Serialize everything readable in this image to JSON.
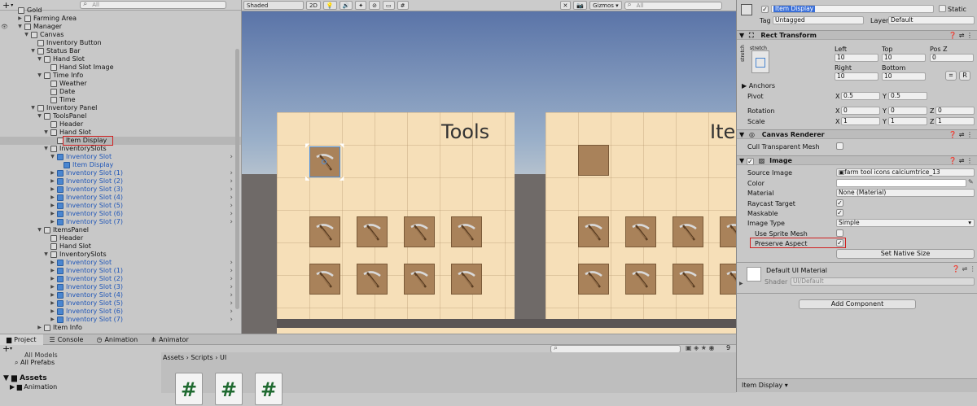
{
  "hierarchy": {
    "search_placeholder": "All",
    "rows": [
      {
        "label": "Gold",
        "indent": 0,
        "tri": "",
        "blue": false,
        "sel": false,
        "chev": false
      },
      {
        "label": "Farming Area",
        "indent": 1,
        "tri": "▶",
        "blue": false,
        "sel": false,
        "chev": false
      },
      {
        "label": "Manager",
        "indent": 1,
        "tri": "▼",
        "blue": false,
        "sel": false,
        "chev": false
      },
      {
        "label": "Canvas",
        "indent": 2,
        "tri": "▼",
        "blue": false,
        "sel": false,
        "chev": false
      },
      {
        "label": "Inventory Button",
        "indent": 3,
        "tri": "",
        "blue": false,
        "sel": false,
        "chev": false
      },
      {
        "label": "Status Bar",
        "indent": 3,
        "tri": "▼",
        "blue": false,
        "sel": false,
        "chev": false
      },
      {
        "label": "Hand Slot",
        "indent": 4,
        "tri": "▼",
        "blue": false,
        "sel": false,
        "chev": false
      },
      {
        "label": "Hand Slot Image",
        "indent": 5,
        "tri": "",
        "blue": false,
        "sel": false,
        "chev": false
      },
      {
        "label": "Time Info",
        "indent": 4,
        "tri": "▼",
        "blue": false,
        "sel": false,
        "chev": false
      },
      {
        "label": "Weather",
        "indent": 5,
        "tri": "",
        "blue": false,
        "sel": false,
        "chev": false
      },
      {
        "label": "Date",
        "indent": 5,
        "tri": "",
        "blue": false,
        "sel": false,
        "chev": false
      },
      {
        "label": "Time",
        "indent": 5,
        "tri": "",
        "blue": false,
        "sel": false,
        "chev": false
      },
      {
        "label": "Inventory Panel",
        "indent": 3,
        "tri": "▼",
        "blue": false,
        "sel": false,
        "chev": false
      },
      {
        "label": "ToolsPanel",
        "indent": 4,
        "tri": "▼",
        "blue": false,
        "sel": false,
        "chev": false
      },
      {
        "label": "Header",
        "indent": 5,
        "tri": "",
        "blue": false,
        "sel": false,
        "chev": false
      },
      {
        "label": "Hand Slot",
        "indent": 5,
        "tri": "▼",
        "blue": false,
        "sel": false,
        "chev": false
      },
      {
        "label": "Item Display",
        "indent": 6,
        "tri": "",
        "blue": false,
        "sel": true,
        "chev": false
      },
      {
        "label": "InventorySlots",
        "indent": 5,
        "tri": "▼",
        "blue": false,
        "sel": false,
        "chev": false
      },
      {
        "label": "Inventory Slot",
        "indent": 6,
        "tri": "▼",
        "blue": true,
        "sel": false,
        "chev": true
      },
      {
        "label": "Item Display",
        "indent": 7,
        "tri": "",
        "blue": true,
        "sel": false,
        "chev": false
      },
      {
        "label": "Inventory Slot (1)",
        "indent": 6,
        "tri": "▶",
        "blue": true,
        "sel": false,
        "chev": true
      },
      {
        "label": "Inventory Slot (2)",
        "indent": 6,
        "tri": "▶",
        "blue": true,
        "sel": false,
        "chev": true
      },
      {
        "label": "Inventory Slot (3)",
        "indent": 6,
        "tri": "▶",
        "blue": true,
        "sel": false,
        "chev": true
      },
      {
        "label": "Inventory Slot (4)",
        "indent": 6,
        "tri": "▶",
        "blue": true,
        "sel": false,
        "chev": true
      },
      {
        "label": "Inventory Slot (5)",
        "indent": 6,
        "tri": "▶",
        "blue": true,
        "sel": false,
        "chev": true
      },
      {
        "label": "Inventory Slot (6)",
        "indent": 6,
        "tri": "▶",
        "blue": true,
        "sel": false,
        "chev": true
      },
      {
        "label": "Inventory Slot (7)",
        "indent": 6,
        "tri": "▶",
        "blue": true,
        "sel": false,
        "chev": true
      },
      {
        "label": "ItemsPanel",
        "indent": 4,
        "tri": "▼",
        "blue": false,
        "sel": false,
        "chev": false
      },
      {
        "label": "Header",
        "indent": 5,
        "tri": "",
        "blue": false,
        "sel": false,
        "chev": false
      },
      {
        "label": "Hand Slot",
        "indent": 5,
        "tri": "",
        "blue": false,
        "sel": false,
        "chev": false
      },
      {
        "label": "InventorySlots",
        "indent": 5,
        "tri": "▼",
        "blue": false,
        "sel": false,
        "chev": false
      },
      {
        "label": "Inventory Slot",
        "indent": 6,
        "tri": "▶",
        "blue": true,
        "sel": false,
        "chev": true
      },
      {
        "label": "Inventory Slot (1)",
        "indent": 6,
        "tri": "▶",
        "blue": true,
        "sel": false,
        "chev": true
      },
      {
        "label": "Inventory Slot (2)",
        "indent": 6,
        "tri": "▶",
        "blue": true,
        "sel": false,
        "chev": true
      },
      {
        "label": "Inventory Slot (3)",
        "indent": 6,
        "tri": "▶",
        "blue": true,
        "sel": false,
        "chev": true
      },
      {
        "label": "Inventory Slot (4)",
        "indent": 6,
        "tri": "▶",
        "blue": true,
        "sel": false,
        "chev": true
      },
      {
        "label": "Inventory Slot (5)",
        "indent": 6,
        "tri": "▶",
        "blue": true,
        "sel": false,
        "chev": true
      },
      {
        "label": "Inventory Slot (6)",
        "indent": 6,
        "tri": "▶",
        "blue": true,
        "sel": false,
        "chev": true
      },
      {
        "label": "Inventory Slot (7)",
        "indent": 6,
        "tri": "▶",
        "blue": true,
        "sel": false,
        "chev": true
      },
      {
        "label": "Item Info",
        "indent": 4,
        "tri": "▶",
        "blue": false,
        "sel": false,
        "chev": false
      }
    ]
  },
  "scene": {
    "shading_mode": "Shaded",
    "mode_2d": "2D",
    "gizmos": "Gizmos",
    "search_placeholder": "All",
    "tools_title": "Tools",
    "items_title": "Item"
  },
  "project": {
    "tabs": [
      "Project",
      "Console",
      "Animation",
      "Animator"
    ],
    "left_items": [
      "All Models",
      "All Prefabs",
      "Assets",
      "Animation"
    ],
    "breadcrumb": "Assets › Scripts › UI",
    "file_glyph": "#",
    "count": "9"
  },
  "inspector": {
    "object_name": "Item Display",
    "static_label": "Static",
    "tag_label": "Tag",
    "tag_value": "Untagged",
    "layer_label": "Layer",
    "layer_value": "Default",
    "rect_transform": {
      "title": "Rect Transform",
      "stretch_top": "stretch",
      "stretch_side": "stretch",
      "left_label": "Left",
      "left_value": "10",
      "top_label": "Top",
      "top_value": "10",
      "posz_label": "Pos Z",
      "posz_value": "0",
      "right_label": "Right",
      "right_value": "10",
      "bottom_label": "Bottom",
      "bottom_value": "10",
      "r_btn": "R",
      "anchors_label": "Anchors",
      "pivot_label": "Pivot",
      "pivot_x": "0.5",
      "pivot_y": "0.5",
      "rotation_label": "Rotation",
      "rot_x": "0",
      "rot_y": "0",
      "rot_z": "0",
      "scale_label": "Scale",
      "scale_x": "1",
      "scale_y": "1",
      "scale_z": "1",
      "axis_x": "X",
      "axis_y": "Y",
      "axis_z": "Z"
    },
    "canvas_renderer": {
      "title": "Canvas Renderer",
      "cull_label": "Cull Transparent Mesh"
    },
    "image": {
      "title": "Image",
      "source_label": "Source Image",
      "source_value": "farm tool icons calciumtrice_13",
      "color_label": "Color",
      "material_label": "Material",
      "material_value": "None (Material)",
      "raycast_label": "Raycast Target",
      "maskable_label": "Maskable",
      "image_type_label": "Image Type",
      "image_type_value": "Simple",
      "sprite_mesh_label": "Use Sprite Mesh",
      "preserve_label": "Preserve Aspect",
      "native_btn": "Set Native Size"
    },
    "material": {
      "title": "Default UI Material",
      "shader_label": "Shader",
      "shader_value": "UI/Default"
    },
    "add_component": "Add Component",
    "footer": "Item Display"
  },
  "colors": {
    "selection_red": "#d02020",
    "prefab_blue": "#1f56b8",
    "panel": "#f6dfb8",
    "slot": "#a9825a"
  }
}
